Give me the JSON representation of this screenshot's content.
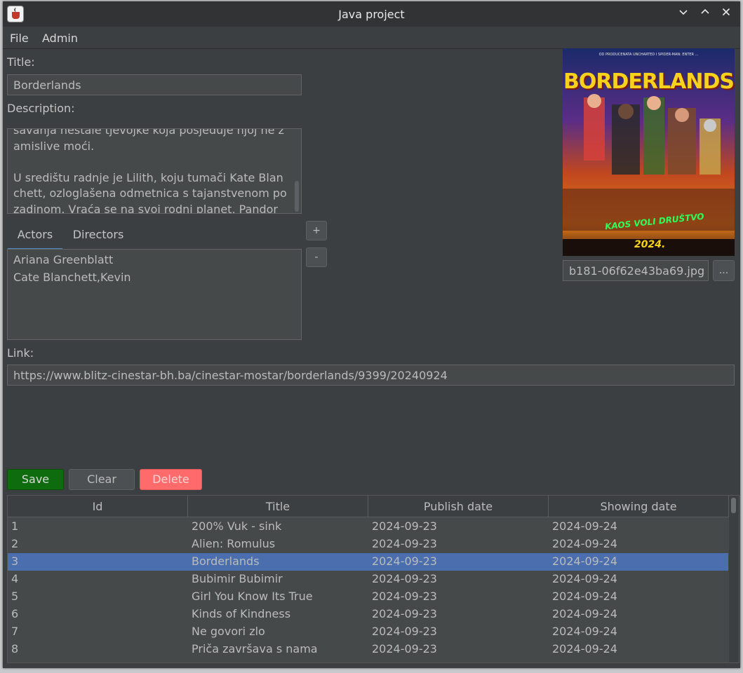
{
  "window": {
    "title": "Java project"
  },
  "menu": [
    "File",
    "Admin"
  ],
  "form": {
    "title_label": "Title:",
    "title_value": "Borderlands",
    "description_label": "Description:",
    "description_text": "savanja nestale tjevojke koja posjeduje njoj ne zamislive moći.\n\nU središtu radnje je Lilith, koju tumači Kate Blanchett, ozloglašena odmetnica s tajanstvenom pozadinom. Vraća se na svoj rodni planet, Pandoru, u",
    "tabs": [
      "Actors",
      "Directors"
    ],
    "actors": [
      "Ariana Greenblatt",
      "Cate Blanchett,Kevin"
    ],
    "add_label": "+",
    "remove_label": "-",
    "image_file": "b181-06f62e43ba69.jpg",
    "browse_label": "...",
    "link_label": "Link:",
    "link_value": "https://www.blitz-cinestar-bh.ba/cinestar-mostar/borderlands/9399/20240924"
  },
  "poster": {
    "top_text": "OD PRODUCENATA UNCHARTED I SPIDER-MAN: ENTER ...",
    "title": "BORDERLANDS",
    "tagline": "KAOS VOLI DRUŠTVO",
    "year": "2024."
  },
  "buttons": {
    "save": "Save",
    "clear": "Clear",
    "delete": "Delete"
  },
  "colors": {
    "save": "#0e6b0e",
    "delete": "#ff6b6b",
    "selection": "#4b6eaf"
  },
  "table": {
    "columns": [
      "Id",
      "Title",
      "Publish date",
      "Showing date"
    ],
    "rows": [
      [
        "1",
        "200% Vuk - sink",
        "2024-09-23",
        "2024-09-24"
      ],
      [
        "2",
        "Alien: Romulus",
        "2024-09-23",
        "2024-09-24"
      ],
      [
        "3",
        "Borderlands",
        "2024-09-23",
        "2024-09-24"
      ],
      [
        "4",
        "Bubimir Bubimir",
        "2024-09-23",
        "2024-09-24"
      ],
      [
        "5",
        "Girl You Know Its True",
        "2024-09-23",
        "2024-09-24"
      ],
      [
        "6",
        "Kinds of Kindness",
        "2024-09-23",
        "2024-09-24"
      ],
      [
        "7",
        "Ne govori zlo",
        "2024-09-23",
        "2024-09-24"
      ],
      [
        "8",
        "Priča završava s nama",
        "2024-09-23",
        "2024-09-24"
      ]
    ],
    "selected_row": 3
  }
}
